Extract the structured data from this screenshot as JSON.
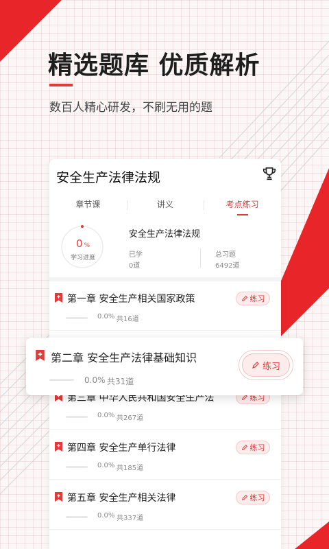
{
  "hero": {
    "headline": "精选题库  优质解析",
    "subline": "数百人精心研发，不刷无用的题"
  },
  "card": {
    "title": "安全生产法律法规",
    "tabs": [
      {
        "label": "章节课"
      },
      {
        "label": "讲义"
      },
      {
        "label": "考点练习",
        "active": true
      }
    ],
    "progress": {
      "value": "0",
      "unit": "%",
      "label": "学习进度",
      "fraction": 0
    },
    "subject": "安全生产法律法规",
    "learned_label": "已学",
    "learned_value": "0道",
    "total_label": "总习题",
    "total_value": "6492道",
    "practice_label": "练习"
  },
  "chapters": [
    {
      "title": "第一章  安全生产相关国家政策",
      "percent": "0.0%",
      "total": "共16道"
    },
    {
      "title": "第二章  安全生产法律基础知识",
      "percent": "0.0%",
      "total": "共31道"
    },
    {
      "title": "第三章  中华人民共和国安全生产法",
      "percent": "0.0%",
      "total": "共267道"
    },
    {
      "title": "第四章  安全生产单行法律",
      "percent": "0.0%",
      "total": "共185道"
    },
    {
      "title": "第五章  安全生产相关法律",
      "percent": "0.0%",
      "total": "共337道"
    }
  ],
  "colors": {
    "accent": "#e03a3a",
    "accent_light": "#fdecec"
  },
  "icons": {
    "trophy": "trophy-icon",
    "bookmark": "bookmark-icon",
    "pen": "pen-icon"
  }
}
